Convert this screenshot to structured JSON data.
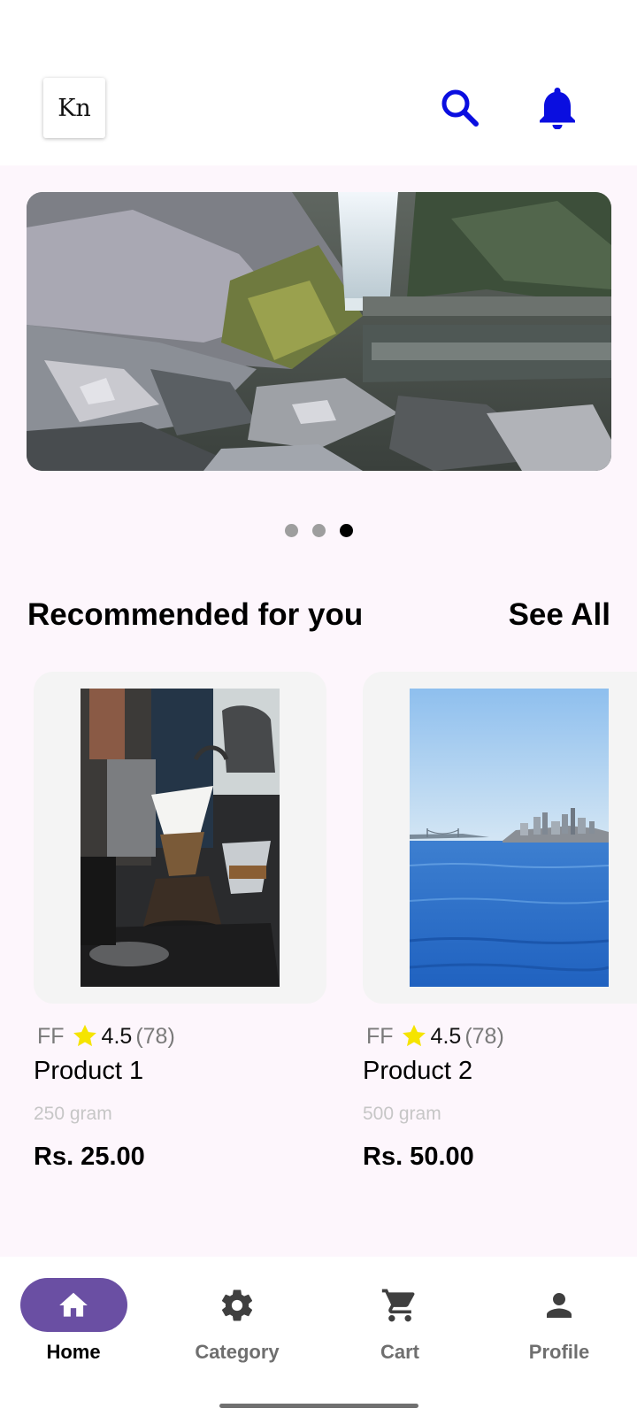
{
  "header": {
    "logo_text": "Kn",
    "search_icon": "search-icon",
    "notification_icon": "bell-icon",
    "accent_color": "#0a0ee0"
  },
  "carousel": {
    "image": "waterfall-landscape",
    "slide_count": 3,
    "active_index": 2
  },
  "recommended": {
    "title": "Recommended for you",
    "see_all_label": "See All",
    "products": [
      {
        "brand": "FF",
        "rating": "4.5",
        "reviews": "(78)",
        "name": "Product 1",
        "weight": "250 gram",
        "price": "Rs. 25.00",
        "image": "coffee-pour-over"
      },
      {
        "brand": "FF",
        "rating": "4.5",
        "reviews": "(78)",
        "name": "Product 2",
        "weight": "500 gram",
        "price": "Rs. 50.00",
        "image": "sea-skyline"
      }
    ]
  },
  "bottom_nav": {
    "items": [
      {
        "label": "Home",
        "icon": "home-icon",
        "active": true
      },
      {
        "label": "Category",
        "icon": "gear-icon",
        "active": false
      },
      {
        "label": "Cart",
        "icon": "cart-icon",
        "active": false
      },
      {
        "label": "Profile",
        "icon": "person-icon",
        "active": false
      }
    ],
    "active_color": "#6a4fa3"
  }
}
